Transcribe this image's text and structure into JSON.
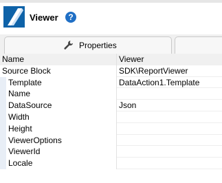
{
  "header": {
    "title": "Viewer"
  },
  "tabs": [
    {
      "label": "Properties",
      "icon": "wrench-icon",
      "selected": true
    },
    {
      "label": "",
      "selected": false
    }
  ],
  "grid": {
    "columns": [
      "Name",
      "Viewer"
    ],
    "rows": [
      {
        "name": "Source Block",
        "value": "SDK\\ReportViewer",
        "child": false
      },
      {
        "name": "Template",
        "value": "DataAction1.Template",
        "child": true
      },
      {
        "name": "Name",
        "value": "",
        "child": true
      },
      {
        "name": "DataSource",
        "value": "Json",
        "child": true
      },
      {
        "name": "Width",
        "value": "",
        "child": true
      },
      {
        "name": "Height",
        "value": "",
        "child": true
      },
      {
        "name": "ViewerOptions",
        "value": "",
        "child": true
      },
      {
        "name": "ViewerId",
        "value": "",
        "child": true
      },
      {
        "name": "Locale",
        "value": "",
        "child": true
      }
    ]
  },
  "colors": {
    "accent": "#0e62a8",
    "help": "#1f6fc5"
  }
}
